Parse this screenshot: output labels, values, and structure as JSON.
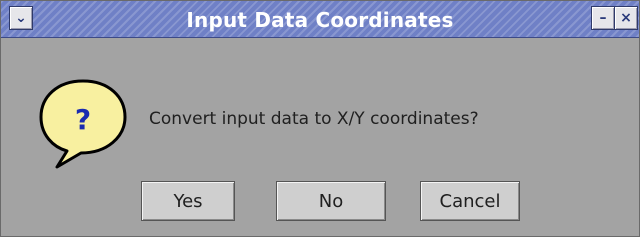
{
  "window": {
    "title": "Input Data Coordinates",
    "menu_glyph": "⌄",
    "minimize_glyph": "–",
    "close_glyph": "×",
    "icons": {
      "menu": "chevron-down-icon",
      "minimize": "minimize-icon",
      "close": "close-icon",
      "question": "question-bubble-icon"
    }
  },
  "dialog": {
    "icon_glyph": "?",
    "message": "Convert input data to X/Y coordinates?",
    "buttons": {
      "yes": "Yes",
      "no": "No",
      "cancel": "Cancel"
    }
  },
  "colors": {
    "titlebar": "#6f80c6",
    "dialog_background": "#a3a3a3",
    "button_face": "#cfcfcf",
    "bubble_fill": "#f8f0a0",
    "bubble_glyph": "#1a2bb0"
  }
}
